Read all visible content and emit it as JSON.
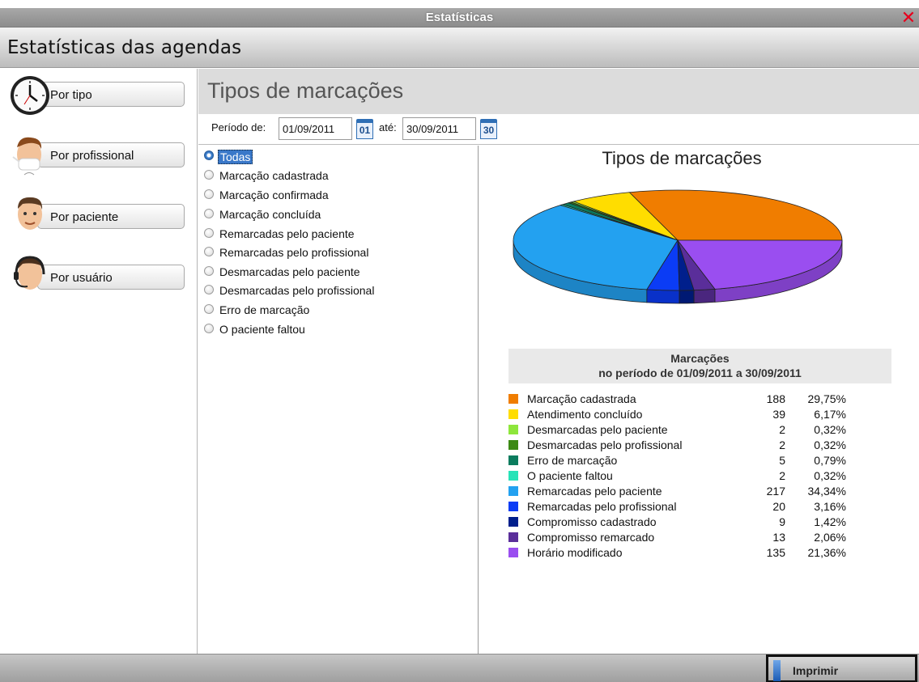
{
  "window": {
    "title": "Estatísticas",
    "close_icon": "close-icon"
  },
  "header": {
    "title": "Estatísticas das agendas"
  },
  "sidebar": {
    "items": [
      {
        "label": "Por tipo",
        "icon": "clock-icon"
      },
      {
        "label": "Por profissional",
        "icon": "doctor-icon"
      },
      {
        "label": "Por paciente",
        "icon": "patient-icon"
      },
      {
        "label": "Por usuário",
        "icon": "headset-user-icon"
      }
    ]
  },
  "main": {
    "title": "Tipos de marcações",
    "period_label": "Período de:",
    "date_from": "01/09/2011",
    "calendar_from_day": "01",
    "until_label": "até:",
    "date_to": "30/09/2011",
    "calendar_to_day": "30"
  },
  "filters": {
    "selected": "Todas",
    "options": [
      "Todas",
      "Marcação cadastrada",
      "Marcação confirmada",
      "Marcação concluída",
      "Remarcadas pelo paciente",
      "Remarcadas pelo profissional",
      "Desmarcadas pelo paciente",
      "Desmarcadas pelo profissional",
      "Erro de marcação",
      "O paciente faltou"
    ]
  },
  "legend": {
    "heading_line1": "Marcações",
    "heading_line2": "no período de 01/09/2011 a 30/09/2011"
  },
  "chart_data": {
    "type": "pie",
    "title": "Tipos de marcações",
    "series": [
      {
        "name": "Marcação cadastrada",
        "value": 188,
        "percent": "29,75%",
        "color": "#f07d00"
      },
      {
        "name": "Atendimento concluído",
        "value": 39,
        "percent": "6,17%",
        "color": "#ffdd00"
      },
      {
        "name": "Desmarcadas pelo paciente",
        "value": 2,
        "percent": "0,32%",
        "color": "#8ee63c"
      },
      {
        "name": "Desmarcadas pelo profissional",
        "value": 2,
        "percent": "0,32%",
        "color": "#3c8a14"
      },
      {
        "name": "Erro de marcação",
        "value": 5,
        "percent": "0,79%",
        "color": "#0b7c5e"
      },
      {
        "name": "O paciente faltou",
        "value": 2,
        "percent": "0,32%",
        "color": "#27e3b8"
      },
      {
        "name": "Remarcadas pelo paciente",
        "value": 217,
        "percent": "34,34%",
        "color": "#23a1f0"
      },
      {
        "name": "Remarcadas pelo profissional",
        "value": 20,
        "percent": "3,16%",
        "color": "#0b3cf5"
      },
      {
        "name": "Compromisso cadastrado",
        "value": 9,
        "percent": "1,42%",
        "color": "#001f8c"
      },
      {
        "name": "Compromisso remarcado",
        "value": 13,
        "percent": "2,06%",
        "color": "#5a2e9a"
      },
      {
        "name": "Horário modificado",
        "value": 135,
        "percent": "21,36%",
        "color": "#9a4ef0"
      }
    ]
  },
  "footer": {
    "print_label": "Imprimir"
  }
}
